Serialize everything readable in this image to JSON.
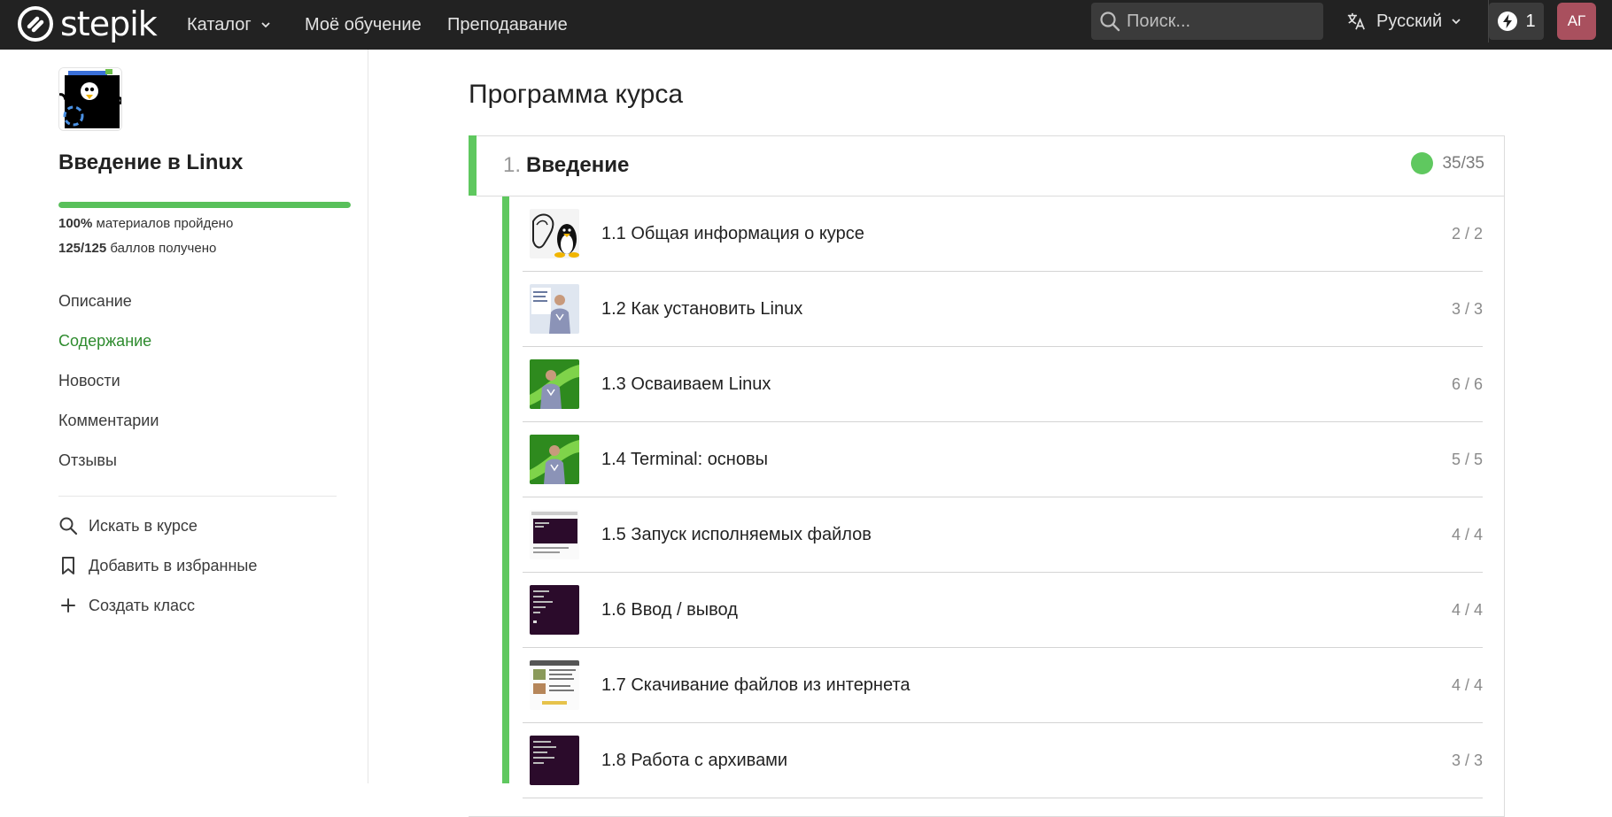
{
  "header": {
    "logo_text": "stepik",
    "nav": [
      {
        "label": "Каталог",
        "has_dropdown": true
      },
      {
        "label": "Моё обучение"
      },
      {
        "label": "Преподавание"
      }
    ],
    "search_placeholder": "Поиск...",
    "language": "Русский",
    "energy_count": "1",
    "avatar_initials": "АГ"
  },
  "sidebar": {
    "course_title": "Введение в Linux",
    "progress_percent": 100,
    "stat_materials_value": "100%",
    "stat_materials_text": "материалов пройдено",
    "stat_points_value": "125/125",
    "stat_points_text": "баллов получено",
    "links": [
      "Описание",
      "Содержание",
      "Новости",
      "Комментарии",
      "Отзывы"
    ],
    "active_link": "Содержание",
    "actions": [
      {
        "label": "Искать в курсе",
        "icon": "search-icon"
      },
      {
        "label": "Добавить в избранные",
        "icon": "bookmark-icon"
      },
      {
        "label": "Создать класс",
        "icon": "plus-icon"
      }
    ]
  },
  "main": {
    "title": "Программа курса",
    "module": {
      "number": "1.",
      "name": "Введение",
      "progress": "35/35",
      "lessons": [
        {
          "name": "1.1 Общая информация о курсе",
          "score": "2 / 2",
          "thumb": "gnu-tux-thumbnail"
        },
        {
          "name": "1.2 Как установить Linux",
          "score": "3 / 3",
          "thumb": "lecturer-slide-thumbnail"
        },
        {
          "name": "1.3 Осваиваем Linux",
          "score": "6 / 6",
          "thumb": "lecturer-green-thumbnail"
        },
        {
          "name": "1.4 Terminal: основы",
          "score": "5 / 5",
          "thumb": "lecturer-green-thumbnail"
        },
        {
          "name": "1.5 Запуск исполняемых файлов",
          "score": "4 / 4",
          "thumb": "terminal-doc-thumbnail"
        },
        {
          "name": "1.6 Ввод / вывод",
          "score": "4 / 4",
          "thumb": "terminal-thumbnail"
        },
        {
          "name": "1.7 Скачивание файлов из интернета",
          "score": "4 / 4",
          "thumb": "webpage-thumbnail"
        },
        {
          "name": "1.8 Работа с архивами",
          "score": "3 / 3",
          "thumb": "terminal-thumbnail"
        }
      ]
    }
  },
  "colors": {
    "topbar": "#222222",
    "accent_green": "#5fc85f",
    "active_link": "#2e8b2e",
    "avatar_bg": "#a9505e"
  }
}
